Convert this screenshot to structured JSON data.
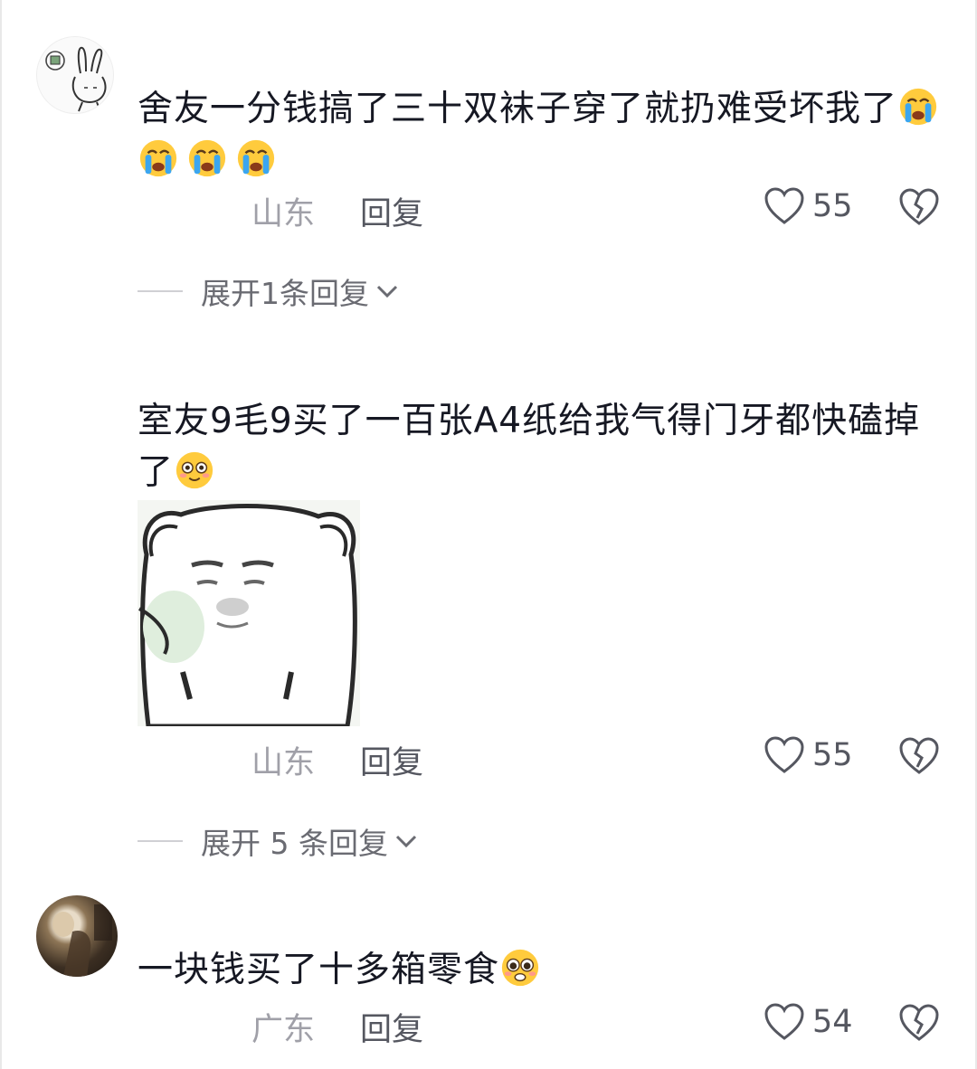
{
  "comments": [
    {
      "text": "舍友一分钱搞了三十双袜子穿了就扔难受坏我了",
      "emoji": [
        "crying-face",
        "crying-face",
        "crying-face",
        "crying-face"
      ],
      "location": "山东",
      "reply_label": "回复",
      "likes": "55",
      "expand_label": "展开1条回复"
    },
    {
      "text": "室友9毛9买了一百张A4纸给我气得门牙都快磕掉了",
      "emoji": [
        "smiling-face"
      ],
      "sticker": "bear-meme-sticker",
      "location": "山东",
      "reply_label": "回复",
      "likes": "55",
      "expand_label": "展开 5 条回复"
    },
    {
      "text": "一块钱买了十多箱零食",
      "emoji": [
        "pleading-face"
      ],
      "location": "广东",
      "reply_label": "回复",
      "likes": "54"
    }
  ],
  "colors": {
    "text": "#161823",
    "meta": "#a0a0a8",
    "action": "#555760",
    "emoji_yellow": "#ffcb3d",
    "tear_blue": "#3ba6f0"
  }
}
